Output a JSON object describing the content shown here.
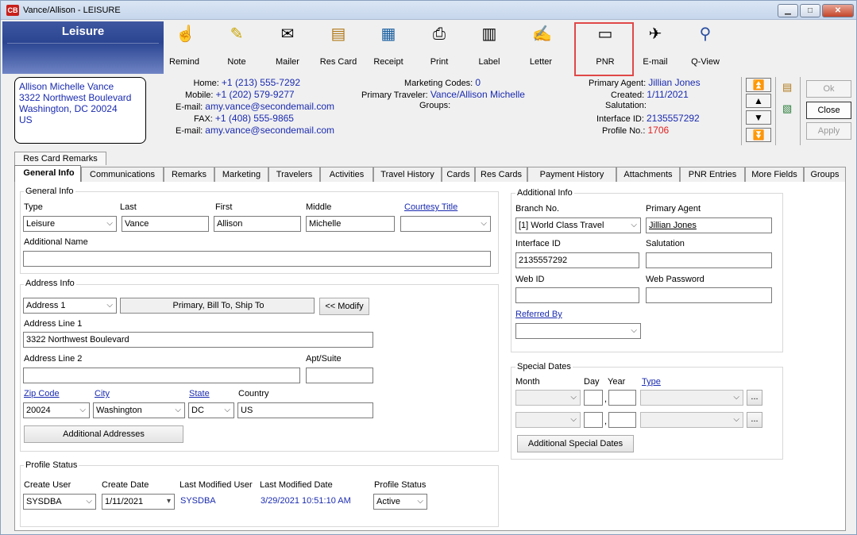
{
  "window": {
    "title": "Vance/Allison - LEISURE",
    "app_badge": "CB"
  },
  "banner": "Leisure",
  "toolbar": [
    {
      "label": "Remind",
      "icon": "hand-pointer-icon"
    },
    {
      "label": "Note",
      "icon": "note-icon"
    },
    {
      "label": "Mailer",
      "icon": "mailer-icon"
    },
    {
      "label": "Res Card",
      "icon": "res-card-icon"
    },
    {
      "label": "Receipt",
      "icon": "receipt-icon"
    },
    {
      "label": "Print",
      "icon": "printer-icon"
    },
    {
      "label": "Label",
      "icon": "label-icon"
    },
    {
      "label": "Letter",
      "icon": "letter-icon"
    },
    {
      "label": "PNR",
      "icon": "pnr-monitor-icon"
    },
    {
      "label": "E-mail",
      "icon": "email-icon"
    },
    {
      "label": "Q-View",
      "icon": "q-view-icon"
    }
  ],
  "address_box": [
    "Allison Michelle Vance",
    "3322 Northwest Boulevard",
    "Washington, DC 20024",
    "US"
  ],
  "contact": {
    "home_label": "Home:",
    "home": "+1 (213) 555-7292",
    "mobile_label": "Mobile:",
    "mobile": "+1 (202) 579-9277",
    "email_label": "E-mail:",
    "email": "amy.vance@secondemail.com",
    "fax_label": "FAX:",
    "fax": "+1 (408) 555-9865",
    "email2_label": "E-mail:",
    "email2": "amy.vance@secondemail.com"
  },
  "marketing": {
    "codes_label": "Marketing Codes:",
    "codes": "0",
    "traveler_label": "Primary Traveler:",
    "traveler": "Vance/Allison Michelle",
    "groups_label": "Groups:"
  },
  "agent": {
    "primary_label": "Primary Agent:",
    "primary": "Jillian Jones",
    "created_label": "Created:",
    "created": "1/11/2021",
    "salutation_label": "Salutation:",
    "interface_label": "Interface ID:",
    "interface": "2135557292",
    "profile_label": "Profile No.:",
    "profile": "1706"
  },
  "buttons": {
    "ok": "Ok",
    "close": "Close",
    "apply": "Apply",
    "modify": "<< Modify",
    "additional_addresses": "Additional Addresses",
    "additional_dates": "Additional Special Dates",
    "ellipsis": "..."
  },
  "remarks_tab": "Res Card Remarks",
  "tabs": [
    "General Info",
    "Communications",
    "Remarks",
    "Marketing",
    "Travelers",
    "Activities",
    "Travel History",
    "Cards",
    "Res Cards",
    "Payment History",
    "Attachments",
    "PNR Entries",
    "More Fields",
    "Groups"
  ],
  "general": {
    "title": "General Info",
    "type_label": "Type",
    "type": "Leisure",
    "last_label": "Last",
    "last": "Vance",
    "first_label": "First",
    "first": "Allison",
    "middle_label": "Middle",
    "middle": "Michelle",
    "courtesy_label": "Courtesy Title",
    "addname_label": "Additional Name"
  },
  "address": {
    "title": "Address Info",
    "which": "Address 1",
    "usage": "Primary, Bill To, Ship To",
    "line1_label": "Address Line 1",
    "line1": "3322 Northwest Boulevard",
    "line2_label": "Address Line 2",
    "apt_label": "Apt/Suite",
    "zip_label": "Zip Code",
    "zip": "20024",
    "city_label": "City",
    "city": "Washington",
    "state_label": "State",
    "state": "DC",
    "country_label": "Country",
    "country": "US"
  },
  "status": {
    "title": "Profile Status",
    "create_user_label": "Create User",
    "create_user": "SYSDBA",
    "create_date_label": "Create Date",
    "create_date": "1/11/2021",
    "mod_user_label": "Last Modified User",
    "mod_user": "SYSDBA",
    "mod_date_label": "Last Modified Date",
    "mod_date": "3/29/2021 10:51:10 AM",
    "status_label": "Profile Status",
    "status": "Active"
  },
  "additional": {
    "title": "Additional Info",
    "branch_label": "Branch No.",
    "branch": "[1] World Class Travel",
    "agent_label": "Primary Agent",
    "agent": "Jillian Jones",
    "interface_label": "Interface ID",
    "interface": "2135557292",
    "salutation_label": "Salutation",
    "webid_label": "Web ID",
    "webpw_label": "Web Password",
    "referred_label": "Referred By"
  },
  "dates": {
    "title": "Special Dates",
    "month_label": "Month",
    "day_label": "Day",
    "year_label": "Year",
    "type_label": "Type"
  }
}
